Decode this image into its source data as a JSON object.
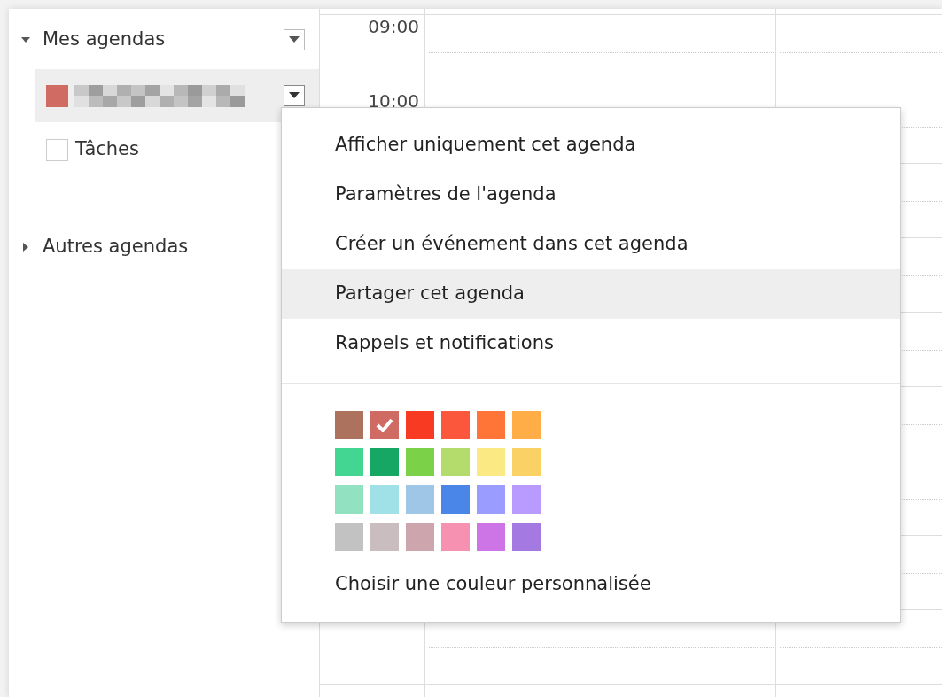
{
  "sidebar": {
    "sections": [
      {
        "label": "Mes agendas",
        "expanded": true,
        "has_menu_button": true,
        "calendars": [
          {
            "kind": "calendar",
            "color": "#d06b64",
            "selected": true
          },
          {
            "kind": "task",
            "label": "Tâches",
            "checked": false
          }
        ]
      },
      {
        "label": "Autres agendas",
        "expanded": false,
        "has_menu_button": false
      }
    ]
  },
  "grid": {
    "time_labels_top": [
      "09:00",
      "10:00"
    ]
  },
  "menu": {
    "items": [
      {
        "label": "Afficher uniquement cet agenda",
        "selected": false
      },
      {
        "label": "Paramètres de l'agenda",
        "selected": false
      },
      {
        "label": "Créer un événement dans cet agenda",
        "selected": false
      },
      {
        "label": "Partager cet agenda",
        "selected": true
      },
      {
        "label": "Rappels et notifications",
        "selected": false
      }
    ],
    "palette": [
      {
        "color": "#ac725e",
        "selected": false
      },
      {
        "color": "#d06b64",
        "selected": true
      },
      {
        "color": "#f83a22",
        "selected": false
      },
      {
        "color": "#fa573c",
        "selected": false
      },
      {
        "color": "#ff7537",
        "selected": false
      },
      {
        "color": "#ffad46",
        "selected": false
      },
      {
        "color": "#42d692",
        "selected": false
      },
      {
        "color": "#16a765",
        "selected": false
      },
      {
        "color": "#7bd148",
        "selected": false
      },
      {
        "color": "#b3dc6c",
        "selected": false
      },
      {
        "color": "#fbe983",
        "selected": false
      },
      {
        "color": "#fad165",
        "selected": false
      },
      {
        "color": "#92e1c0",
        "selected": false
      },
      {
        "color": "#9fe1e7",
        "selected": false
      },
      {
        "color": "#9fc6e7",
        "selected": false
      },
      {
        "color": "#4986e7",
        "selected": false
      },
      {
        "color": "#9a9cff",
        "selected": false
      },
      {
        "color": "#b99aff",
        "selected": false
      },
      {
        "color": "#c2c2c2",
        "selected": false
      },
      {
        "color": "#cabdbf",
        "selected": false
      },
      {
        "color": "#cca6ac",
        "selected": false
      },
      {
        "color": "#f691b2",
        "selected": false
      },
      {
        "color": "#cd74e6",
        "selected": false
      },
      {
        "color": "#a47ae2",
        "selected": false
      }
    ],
    "custom_color_link": "Choisir une couleur personnalisée"
  }
}
